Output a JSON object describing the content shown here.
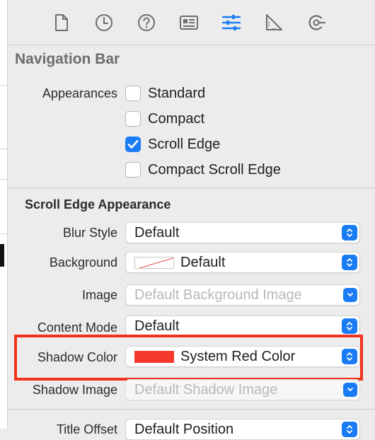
{
  "toolbar": {
    "icons": [
      "file-icon",
      "history-icon",
      "help-icon",
      "identity-icon",
      "attributes-icon",
      "size-icon",
      "connections-icon"
    ],
    "active_index": 4,
    "accent_color": "#1a7cf5"
  },
  "section": {
    "title": "Navigation Bar",
    "appearances_label": "Appearances",
    "appearances": [
      {
        "label": "Standard",
        "checked": false
      },
      {
        "label": "Compact",
        "checked": false
      },
      {
        "label": "Scroll Edge",
        "checked": true
      },
      {
        "label": "Compact Scroll Edge",
        "checked": false
      }
    ]
  },
  "scroll_edge": {
    "title": "Scroll Edge Appearance",
    "blur_style": {
      "label": "Blur Style",
      "value": "Default"
    },
    "background": {
      "label": "Background",
      "value": "Default"
    },
    "image": {
      "label": "Image",
      "placeholder": "Default Background Image"
    },
    "content_mode": {
      "label": "Content Mode",
      "value": "Default"
    },
    "shadow_color": {
      "label": "Shadow Color",
      "value": "System Red Color",
      "swatch": "#f5382b"
    },
    "shadow_image": {
      "label": "Shadow Image",
      "placeholder": "Default Shadow Image"
    },
    "title_offset": {
      "label": "Title Offset",
      "value": "Default Position"
    }
  },
  "highlight_color": "#f0331c"
}
